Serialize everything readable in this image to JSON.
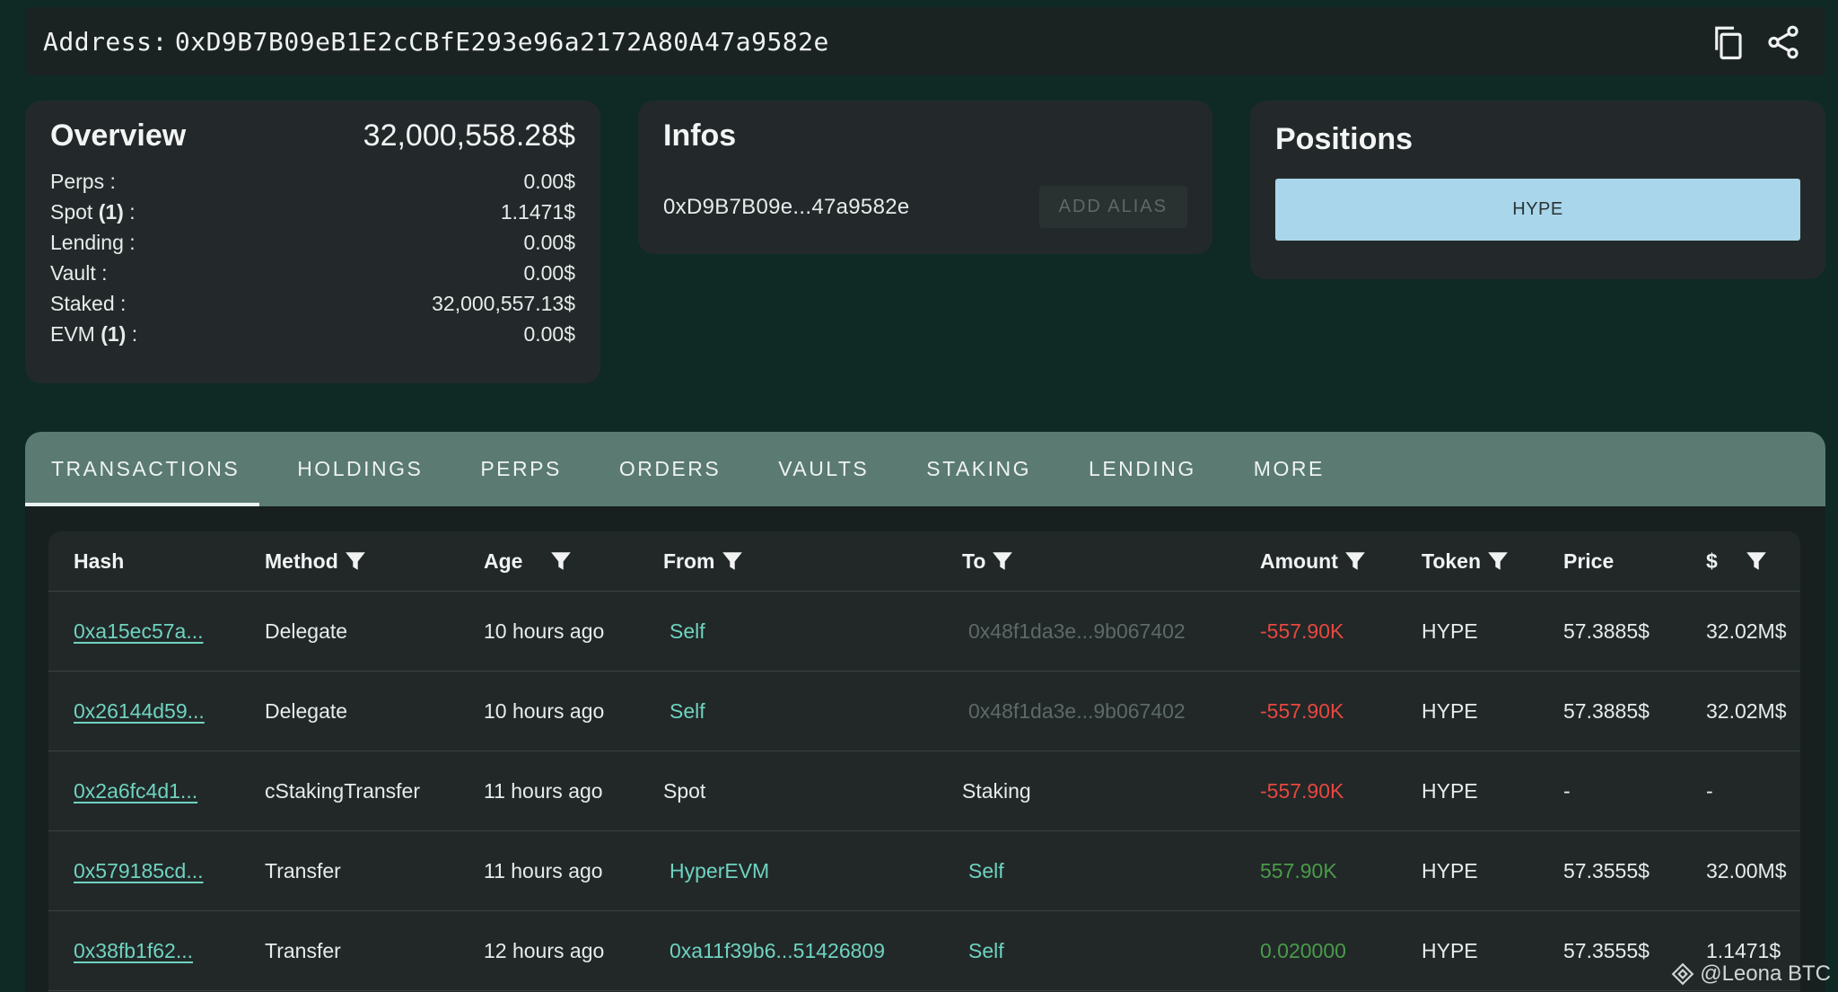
{
  "address_bar": {
    "label": "Address:",
    "address": "0xD9B7B09eB1E2cCBfE293e96a2172A80A47a9582e"
  },
  "overview": {
    "title": "Overview",
    "total": "32,000,558.28$",
    "rows": [
      {
        "label": "Perps :",
        "bold": "",
        "value": "0.00$"
      },
      {
        "label": "Spot ",
        "bold": "(1)",
        "suffix": " :",
        "value": "1.1471$"
      },
      {
        "label": "Lending :",
        "bold": "",
        "value": "0.00$"
      },
      {
        "label": "Vault :",
        "bold": "",
        "value": "0.00$"
      },
      {
        "label": "Staked :",
        "bold": "",
        "value": "32,000,557.13$"
      },
      {
        "label": "EVM ",
        "bold": "(1)",
        "suffix": " :",
        "value": "0.00$"
      }
    ]
  },
  "infos": {
    "title": "Infos",
    "short_address": "0xD9B7B09e...47a9582e",
    "add_alias": "ADD ALIAS"
  },
  "positions": {
    "title": "Positions",
    "items": [
      "HYPE"
    ]
  },
  "tabs": [
    "TRANSACTIONS",
    "HOLDINGS",
    "PERPS",
    "ORDERS",
    "VAULTS",
    "STAKING",
    "LENDING",
    "MORE"
  ],
  "table": {
    "headers": [
      "Hash",
      "Method",
      "Age",
      "From",
      "To",
      "Amount",
      "Token",
      "Price",
      "$"
    ],
    "rows": [
      {
        "hash": "0xa15ec57a...",
        "method": "Delegate",
        "age": "10 hours ago",
        "from": "Self",
        "to": "0x48f1da3e...9b067402",
        "amount": "-557.90K",
        "token": "HYPE",
        "price": "57.3885$",
        "usd": "32.02M$"
      },
      {
        "hash": "0x26144d59...",
        "method": "Delegate",
        "age": "10 hours ago",
        "from": "Self",
        "to": "0x48f1da3e...9b067402",
        "amount": "-557.90K",
        "token": "HYPE",
        "price": "57.3885$",
        "usd": "32.02M$"
      },
      {
        "hash": "0x2a6fc4d1...",
        "method": "cStakingTransfer",
        "age": "11 hours ago",
        "from": "Spot",
        "to": "Staking",
        "amount": "-557.90K",
        "token": "HYPE",
        "price": "-",
        "usd": "-"
      },
      {
        "hash": "0x579185cd...",
        "method": "Transfer",
        "age": "11 hours ago",
        "from": "HyperEVM",
        "to": "Self",
        "amount": "557.90K",
        "token": "HYPE",
        "price": "57.3555$",
        "usd": "32.00M$"
      },
      {
        "hash": "0x38fb1f62...",
        "method": "Transfer",
        "age": "12 hours ago",
        "from": "0xa11f39b6...51426809",
        "to": "Self",
        "amount": "0.020000",
        "token": "HYPE",
        "price": "57.3555$",
        "usd": "1.1471$"
      }
    ]
  },
  "watermark": "@Leona BTC",
  "colors": {
    "background": "#0f2a25",
    "card": "#23292a",
    "tab_bar": "#5a7a72",
    "link": "#6fd3c0",
    "negative": "#e8473f",
    "positive": "#4a9b4a",
    "position_chip": "#a9d6ea"
  }
}
